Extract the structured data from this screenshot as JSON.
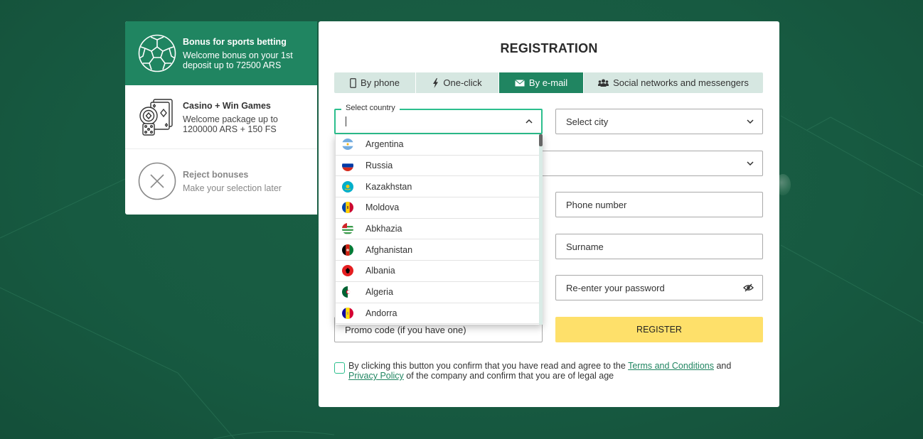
{
  "bonus_panel": {
    "items": [
      {
        "title": "Bonus for sports betting",
        "description": "Welcome bonus on your 1st deposit up to 72500 ARS",
        "icon": "soccer-ball-icon",
        "selected": true
      },
      {
        "title": "Casino + Win Games",
        "description": "Welcome package up to 1200000 ARS + 150 FS",
        "icon": "casino-icon",
        "selected": false
      },
      {
        "title": "Reject bonuses",
        "description": "Make your selection later",
        "icon": "reject-icon",
        "selected": false
      }
    ]
  },
  "registration": {
    "title": "REGISTRATION",
    "tabs": [
      {
        "label": "By phone",
        "icon": "mobile-phone-icon",
        "active": false
      },
      {
        "label": "One-click",
        "icon": "lightning-icon",
        "active": false
      },
      {
        "label": "By e-mail",
        "icon": "envelope-icon",
        "active": true
      },
      {
        "label": "Social networks and messengers",
        "icon": "users-icon",
        "active": false
      }
    ],
    "fields": {
      "country_label": "Select country",
      "country_value": "",
      "city_placeholder": "Select city",
      "currency_value": "",
      "phone_placeholder": "Phone number",
      "surname_placeholder": "Surname",
      "repassword_placeholder": "Re-enter your password",
      "promo_placeholder": "Promo code (if you have one)"
    },
    "register_label": "REGISTER",
    "terms": {
      "text_before": "By clicking this button you confirm that you have read and agree to the",
      "terms_link": "Terms and Conditions",
      "and": "and",
      "privacy_link": "Privacy Policy",
      "text_after": "of the company and confirm that you are of legal age",
      "checked": false
    }
  },
  "country_dropdown": {
    "options": [
      {
        "name": "Argentina",
        "flag": "argentina"
      },
      {
        "name": "Russia",
        "flag": "russia"
      },
      {
        "name": "Kazakhstan",
        "flag": "kazakhstan"
      },
      {
        "name": "Moldova",
        "flag": "moldova"
      },
      {
        "name": "Abkhazia",
        "flag": "abkhazia"
      },
      {
        "name": "Afghanistan",
        "flag": "afghanistan"
      },
      {
        "name": "Albania",
        "flag": "albania"
      },
      {
        "name": "Algeria",
        "flag": "algeria"
      },
      {
        "name": "Andorra",
        "flag": "andorra"
      }
    ]
  },
  "colors": {
    "brand_green": "#208561",
    "focus_green": "#2cbf8d",
    "tab_bg": "#d6e7e1",
    "register_yellow": "#fee06a",
    "background": "#185a40"
  }
}
